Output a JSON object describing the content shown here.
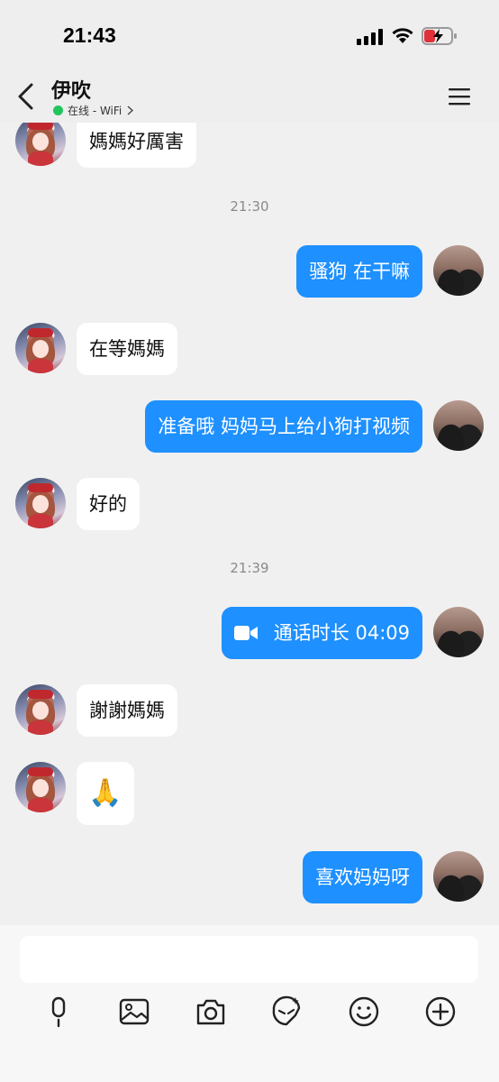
{
  "status_bar": {
    "time": "21:43"
  },
  "header": {
    "contact_name": "伊吹",
    "presence_text": "在线 - WiFi",
    "presence_color": "#22c55e"
  },
  "messages": {
    "m1": "媽媽好厲害",
    "t1": "21:30",
    "m2": "骚狗  在干嘛",
    "m3": "在等媽媽",
    "m4": "准备哦  妈妈马上给小狗打视频",
    "m5": "好的",
    "t2": "21:39",
    "m6_call": "通话时长 04:09",
    "m7": "謝謝媽媽",
    "m8": "🙏",
    "m9": "喜欢妈妈呀"
  },
  "colors": {
    "outgoing_bubble": "#1e90ff",
    "incoming_bubble": "#ffffff",
    "background": "#f0f0f0"
  },
  "toolbar": {
    "icons": [
      "microphone-icon",
      "image-icon",
      "camera-icon",
      "sticker-icon",
      "emoji-icon",
      "plus-icon"
    ]
  }
}
